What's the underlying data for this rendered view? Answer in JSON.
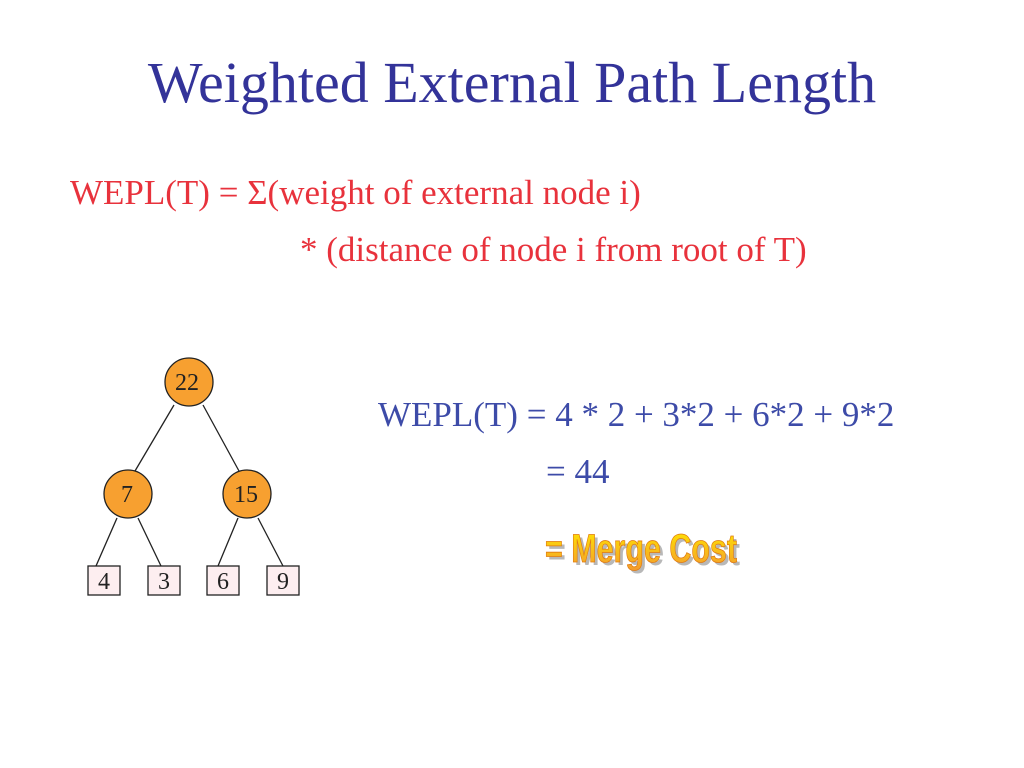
{
  "slide": {
    "title": "Weighted External Path Length",
    "definition": {
      "line1": "WEPL(T) = Σ(weight of external node i)",
      "line2": "* (distance of node i from root of T)"
    },
    "calculation": {
      "line1": "WEPL(T) = 4 * 2 + 3*2 + 6*2 + 9*2",
      "line2": "= 44"
    },
    "callout": "= Merge Cost"
  },
  "tree": {
    "internal_nodes": [
      {
        "id": "root",
        "value": "22",
        "children": [
          "left",
          "right"
        ]
      },
      {
        "id": "left",
        "value": "7",
        "children": [
          "leaf-4",
          "leaf-3"
        ]
      },
      {
        "id": "right",
        "value": "15",
        "children": [
          "leaf-6",
          "leaf-9"
        ]
      }
    ],
    "external_nodes": [
      {
        "id": "leaf-4",
        "value": "4"
      },
      {
        "id": "leaf-3",
        "value": "3"
      },
      {
        "id": "leaf-6",
        "value": "6"
      },
      {
        "id": "leaf-9",
        "value": "9"
      }
    ]
  },
  "colors": {
    "title": "#333399",
    "definition": "#e8323c",
    "calculation": "#3d4ba8",
    "internal_node_fill": "#f7a030",
    "external_node_fill": "#fdeef0",
    "callout_gradient": [
      "#ffe800",
      "#f39a2e"
    ]
  }
}
